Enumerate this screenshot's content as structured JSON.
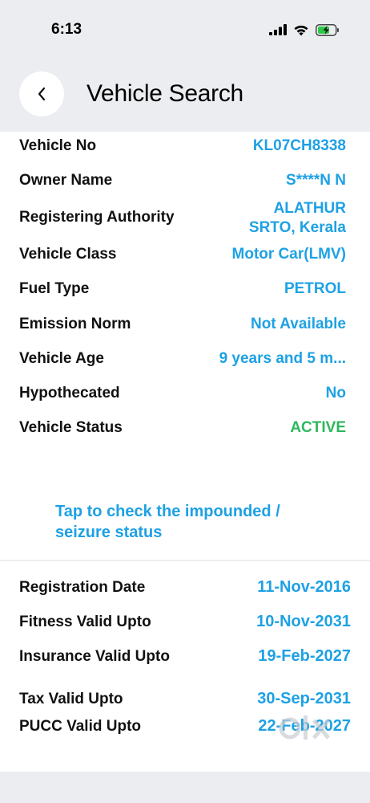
{
  "status_bar": {
    "time": "6:13"
  },
  "header": {
    "title": "Vehicle Search"
  },
  "vehicle_details": [
    {
      "label": "Vehicle No",
      "value": "KL07CH8338"
    },
    {
      "label": "Owner Name",
      "value": "S****N N"
    },
    {
      "label": "Registering Authority",
      "value_line1": "ALATHUR",
      "value_line2": "SRTO, Kerala"
    },
    {
      "label": "Vehicle Class",
      "value": "Motor Car(LMV)"
    },
    {
      "label": "Fuel Type",
      "value": "PETROL"
    },
    {
      "label": "Emission Norm",
      "value": "Not Available"
    },
    {
      "label": "Vehicle Age",
      "value": "9 years and 5 m..."
    },
    {
      "label": "Hypothecated",
      "value": "No"
    },
    {
      "label": "Vehicle Status",
      "value": "ACTIVE"
    }
  ],
  "impound_link": {
    "line1": "Tap to check the impounded /",
    "line2": "seizure status"
  },
  "validity_details": [
    {
      "label": "Registration Date",
      "value": "11-Nov-2016"
    },
    {
      "label": "Fitness Valid Upto",
      "value": "10-Nov-2031"
    },
    {
      "label": "Insurance Valid Upto",
      "value": "19-Feb-2027"
    },
    {
      "label": "Tax Valid Upto",
      "value": "30-Sep-2031"
    },
    {
      "label": "PUCC Valid Upto",
      "value": "22-Feb-2027"
    }
  ],
  "colors": {
    "accent": "#1ea1e4",
    "status_active": "#2eb85c",
    "background": "#ebedf0"
  },
  "icons": [
    "signal-icon",
    "wifi-icon",
    "battery-charging-icon",
    "back-chevron-icon",
    "olx-watermark-logo"
  ],
  "watermark": "OLX"
}
